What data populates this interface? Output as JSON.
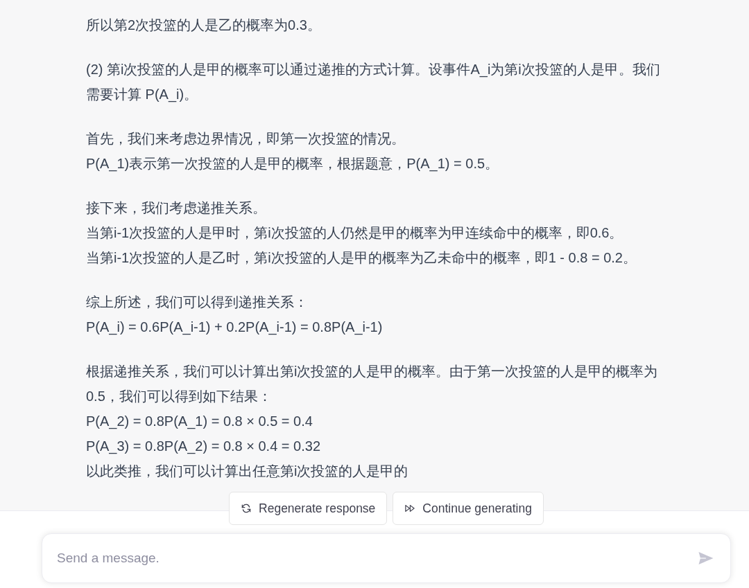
{
  "message": {
    "paragraphs": [
      {
        "lines": [
          "所以第2次投篮的人是乙的概率为0.3。"
        ]
      },
      {
        "lines": [
          "(2) 第i次投篮的人是甲的概率可以通过递推的方式计算。设事件A_i为第i次投篮的人是甲。我们需要计算 P(A_i)。"
        ]
      },
      {
        "lines": [
          "首先，我们来考虑边界情况，即第一次投篮的情况。",
          "P(A_1)表示第一次投篮的人是甲的概率，根据题意，P(A_1) = 0.5。"
        ]
      },
      {
        "lines": [
          "接下来，我们考虑递推关系。",
          "当第i-1次投篮的人是甲时，第i次投篮的人仍然是甲的概率为甲连续命中的概率，即0.6。",
          "当第i-1次投篮的人是乙时，第i次投篮的人是甲的概率为乙未命中的概率，即1 - 0.8 = 0.2。"
        ]
      },
      {
        "lines": [
          "综上所述，我们可以得到递推关系：",
          "P(A_i) = 0.6P(A_i-1) + 0.2P(A_i-1) = 0.8P(A_i-1)"
        ]
      },
      {
        "lines": [
          "根据递推关系，我们可以计算出第i次投篮的人是甲的概率。由于第一次投篮的人是甲的概率为0.5，我们可以得到如下结果：",
          "P(A_2) = 0.8P(A_1) = 0.8 × 0.5 = 0.4",
          "P(A_3) = 0.8P(A_2) = 0.8 × 0.4 = 0.32",
          "以此类推，我们可以计算出任意第i次投篮的人是甲的"
        ]
      }
    ]
  },
  "actions": [
    {
      "kind": "regenerate",
      "label": "Regenerate response"
    },
    {
      "kind": "continue",
      "label": "Continue generating"
    }
  ],
  "composer": {
    "placeholder": "Send a message.",
    "send_button": {
      "disabled": true
    }
  }
}
